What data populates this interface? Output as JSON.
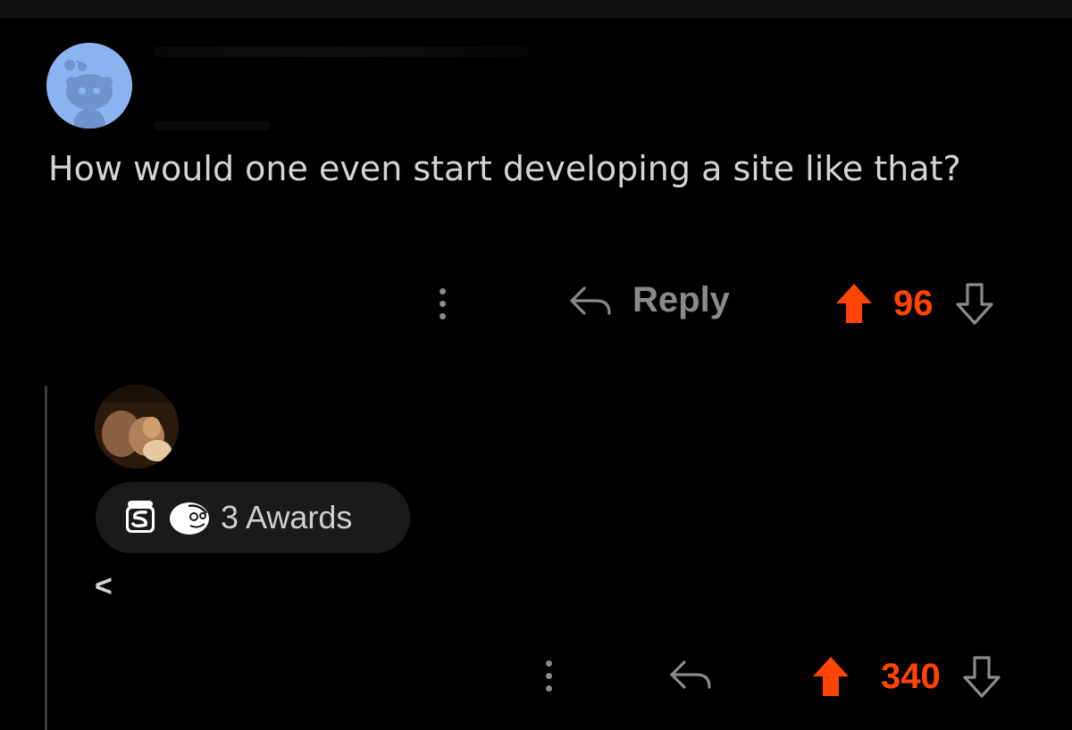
{
  "parent_comment": {
    "body": "How would one even start developing a site like that?",
    "reply_label": "Reply",
    "score": "96"
  },
  "child_comment": {
    "awards_label": "3 Awards",
    "body": "<",
    "score": "340"
  },
  "icons": [
    "more-icon",
    "reply-icon",
    "upvote-icon",
    "downvote-icon",
    "award-icon"
  ],
  "colors": {
    "background": "#000000",
    "upvote_active": "#ff4500",
    "muted": "#8a8a8a",
    "text": "#d4d4d4",
    "avatar_default": "#8ab4f0",
    "awards_pill": "#1a1a1b"
  }
}
